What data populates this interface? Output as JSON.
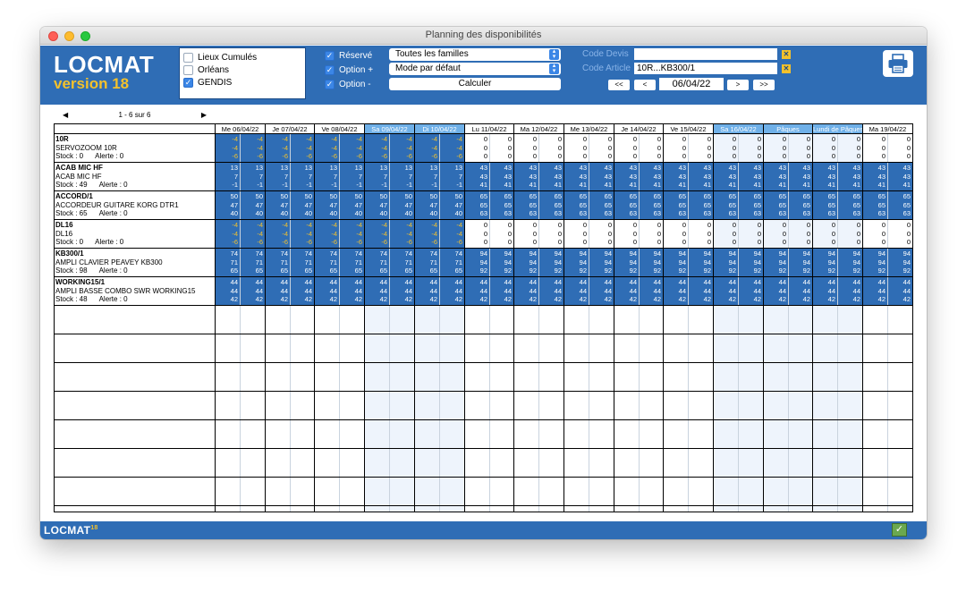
{
  "window": {
    "title": "Planning des disponibilités"
  },
  "colors": {
    "brand": "#2f6db5",
    "accent": "#f3c12c",
    "weekend_header": "#6fb0e8"
  },
  "logo": {
    "name": "LOCMAT",
    "version": "version 18"
  },
  "sites": [
    {
      "label": "Lieux Cumulés",
      "checked": false
    },
    {
      "label": "Orléans",
      "checked": false
    },
    {
      "label": "GENDIS",
      "checked": true
    }
  ],
  "filters": {
    "reserve_label": "Réservé",
    "option_plus_label": "Option +",
    "option_minus_label": "Option -",
    "family_select": "Toutes les familles",
    "mode_select": "Mode par défaut",
    "calc_button": "Calculer"
  },
  "codes": {
    "devis_label": "Code Devis",
    "devis_value": "",
    "article_label": "Code Article",
    "article_value": "10R...KB300/1"
  },
  "nav": {
    "first": "<<",
    "prev": "<",
    "date": "06/04/22",
    "next": ">",
    "last": ">>"
  },
  "pager": {
    "prev": "◀",
    "text": "1 - 6 sur 6",
    "next": "▶"
  },
  "dates": [
    {
      "label": "Me 06/04/22",
      "weekend": false
    },
    {
      "label": "Je 07/04/22",
      "weekend": false
    },
    {
      "label": "Ve 08/04/22",
      "weekend": false
    },
    {
      "label": "Sa 09/04/22",
      "weekend": true
    },
    {
      "label": "Di 10/04/22",
      "weekend": true
    },
    {
      "label": "Lu 11/04/22",
      "weekend": false
    },
    {
      "label": "Ma 12/04/22",
      "weekend": false
    },
    {
      "label": "Me 13/04/22",
      "weekend": false
    },
    {
      "label": "Je 14/04/22",
      "weekend": false
    },
    {
      "label": "Ve 15/04/22",
      "weekend": false
    },
    {
      "label": "Sa 16/04/22",
      "weekend": true
    },
    {
      "label": "Pâques",
      "weekend": true
    },
    {
      "label": "Lundi de Pâques",
      "weekend": true
    },
    {
      "label": "Ma 19/04/22",
      "weekend": false
    }
  ],
  "items": [
    {
      "code": "10R",
      "name": "SERVOZOOM 10R",
      "stock": "Stock : 0",
      "alert": "Alerte : 0",
      "early": [
        "-4",
        "-4",
        "-6"
      ],
      "late": [
        "0",
        "0",
        "0"
      ],
      "early_neg": true,
      "late_white": true
    },
    {
      "code": "ACAB MIC HF",
      "name": "ACAB MIC HF",
      "stock": "Stock : 49",
      "alert": "Alerte : 0",
      "early": [
        "13",
        "7",
        "-1"
      ],
      "late": [
        "43",
        "43",
        "41"
      ],
      "early_neg": false,
      "late_white": false
    },
    {
      "code": "ACCORD/1",
      "name": "ACCORDEUR GUITARE KORG DTR1",
      "stock": "Stock : 65",
      "alert": "Alerte : 0",
      "early": [
        "50",
        "47",
        "40"
      ],
      "late": [
        "65",
        "65",
        "63"
      ],
      "early_neg": false,
      "late_white": false
    },
    {
      "code": "DL16",
      "name": "DL16",
      "stock": "Stock : 0",
      "alert": "Alerte : 0",
      "early": [
        "-4",
        "-4",
        "-6"
      ],
      "late": [
        "0",
        "0",
        "0"
      ],
      "early_neg": true,
      "late_white": true
    },
    {
      "code": "KB300/1",
      "name": "AMPLI CLAVIER PEAVEY KB300",
      "stock": "Stock : 98",
      "alert": "Alerte : 0",
      "early": [
        "74",
        "71",
        "65"
      ],
      "late": [
        "94",
        "94",
        "92"
      ],
      "early_neg": false,
      "late_white": false
    },
    {
      "code": "WORKING15/1",
      "name": "AMPLI BASSE COMBO SWR WORKING15",
      "stock": "Stock : 48",
      "alert": "Alerte : 0",
      "early": [
        "44",
        "44",
        "42"
      ],
      "late": [
        "44",
        "44",
        "42"
      ],
      "early_neg": false,
      "late_white": false
    }
  ],
  "footer": {
    "brand": "LOCMAT",
    "version": "18"
  }
}
